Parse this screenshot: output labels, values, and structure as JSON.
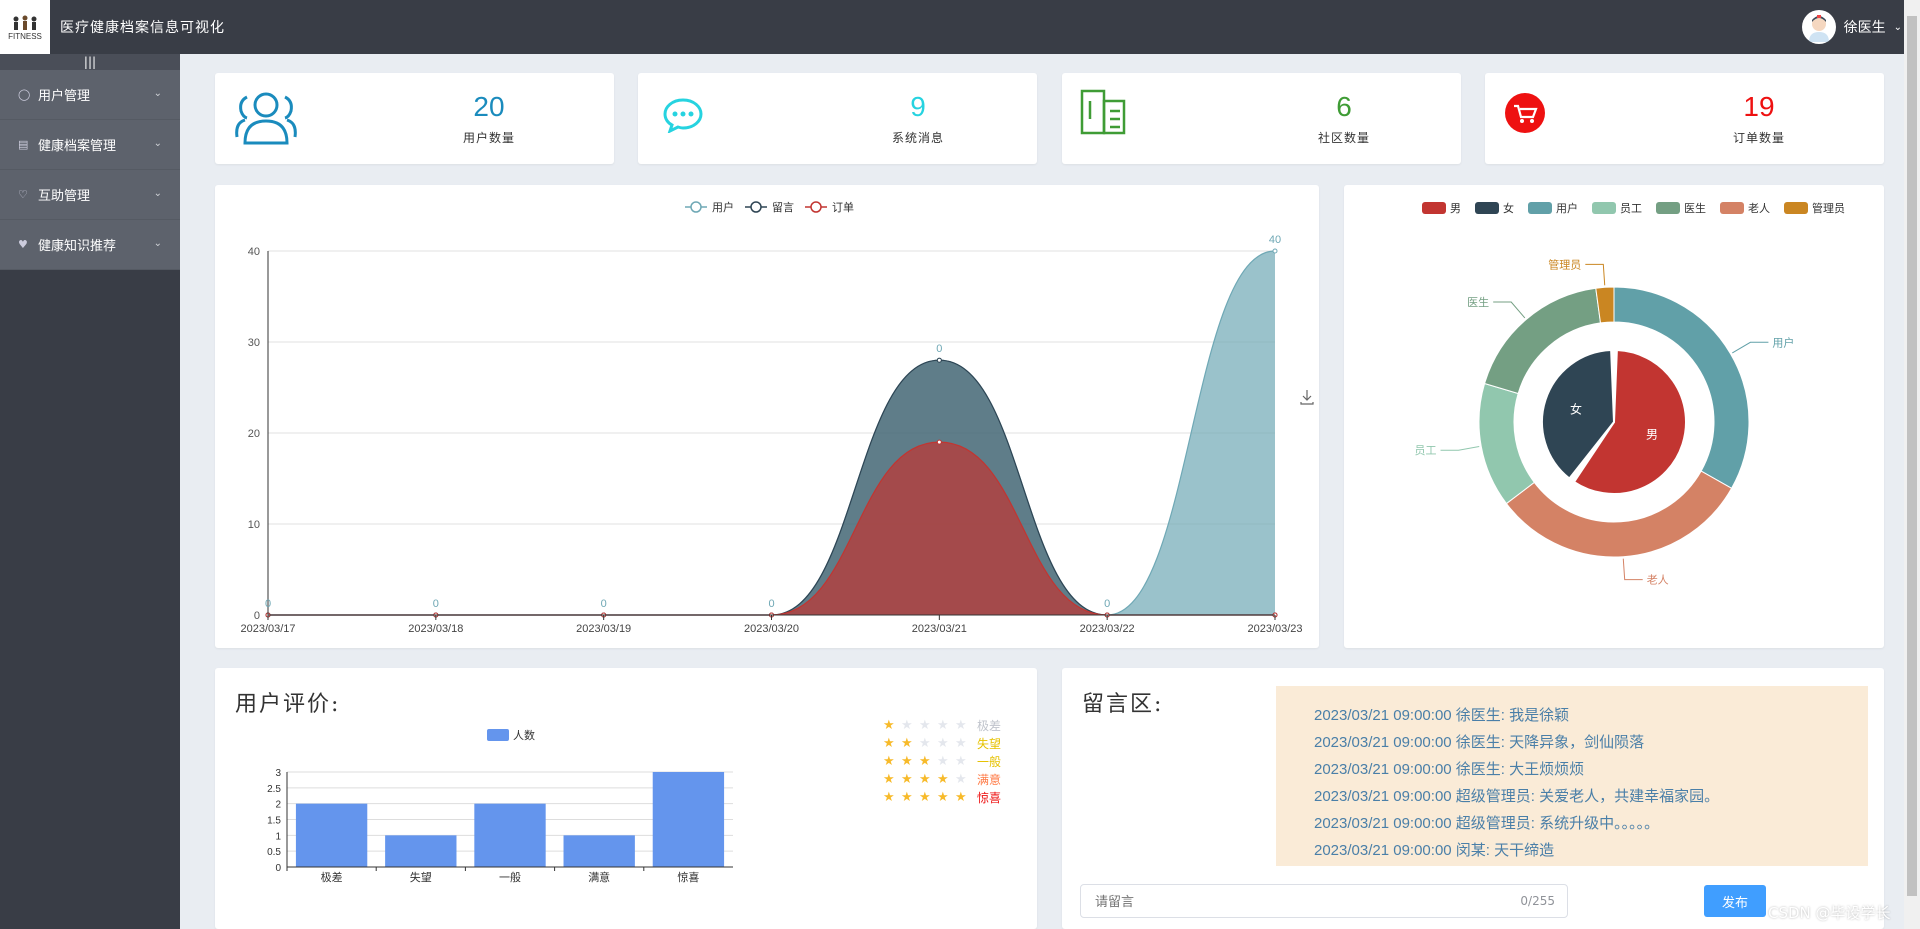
{
  "header": {
    "logo_text": "FITNESS",
    "app_title": "医疗健康档案信息可视化",
    "user_name": "徐医生"
  },
  "sidebar": {
    "toggle": "|||",
    "items": [
      {
        "label": "用户管理",
        "icon": "user-icon"
      },
      {
        "label": "健康档案管理",
        "icon": "file-icon"
      },
      {
        "label": "互助管理",
        "icon": "heart-icon"
      },
      {
        "label": "健康知识推荐",
        "icon": "heartbeat-icon"
      }
    ]
  },
  "stats": [
    {
      "value": "20",
      "label": "用户数量",
      "icon": "users-icon",
      "color": "#1a8bbd"
    },
    {
      "value": "9",
      "label": "系统消息",
      "icon": "chat-icon",
      "color": "#26d3e0"
    },
    {
      "value": "6",
      "label": "社区数量",
      "icon": "building-icon",
      "color": "#3f9c35"
    },
    {
      "value": "19",
      "label": "订单数量",
      "icon": "cart-icon",
      "color": "#ee1111"
    }
  ],
  "line_chart": {
    "chart_data": {
      "type": "area",
      "x": [
        "2023/03/17",
        "2023/03/18",
        "2023/03/19",
        "2023/03/20",
        "2023/03/21",
        "2023/03/22",
        "2023/03/23"
      ],
      "ylim": [
        0,
        40
      ],
      "yticks": [
        0,
        10,
        20,
        30,
        40
      ],
      "grid": true,
      "legend_position": "top",
      "series": [
        {
          "name": "用户",
          "color": "#6fa8b5",
          "values": [
            0,
            0,
            0,
            0,
            28,
            0,
            40
          ]
        },
        {
          "name": "留言",
          "color": "#2f4554",
          "values": [
            0,
            0,
            0,
            0,
            28,
            0,
            0
          ]
        },
        {
          "name": "订单",
          "color": "#c23531",
          "values": [
            0,
            0,
            0,
            0,
            19,
            0,
            0
          ]
        }
      ],
      "data_labels": [
        "0",
        "0",
        "0",
        "0",
        "0",
        "0",
        "40"
      ]
    }
  },
  "pie_chart": {
    "chart_data": {
      "type": "pie",
      "legend_position": "top",
      "legend": [
        "男",
        "女",
        "用户",
        "员工",
        "医生",
        "老人",
        "管理员"
      ],
      "inner": [
        {
          "name": "男",
          "value": 12,
          "color": "#c23531"
        },
        {
          "name": "女",
          "value": 8,
          "color": "#2f4554"
        }
      ],
      "outer": [
        {
          "name": "用户",
          "value": 20,
          "color": "#61a0a8"
        },
        {
          "name": "老人",
          "value": 19,
          "color": "#d48265"
        },
        {
          "name": "员工",
          "value": 9,
          "color": "#91c7ae"
        },
        {
          "name": "医生",
          "value": 11,
          "color": "#749f83"
        },
        {
          "name": "管理员",
          "value": 1.3,
          "color": "#ca8622"
        }
      ]
    }
  },
  "rating": {
    "title": "用户评价:",
    "chart_data": {
      "type": "bar",
      "legend": [
        "人数"
      ],
      "legend_position": "top",
      "categories": [
        "极差",
        "失望",
        "一般",
        "满意",
        "惊喜"
      ],
      "series": [
        {
          "name": "人数",
          "values": [
            2,
            1,
            2,
            1,
            3
          ]
        }
      ],
      "ylim": [
        0,
        3
      ],
      "yticks": [
        "0",
        "0.5",
        "1",
        "1.5",
        "2",
        "2.5",
        "3"
      ],
      "color": "#6495ed"
    },
    "stars": [
      {
        "filled": 1,
        "label": "极差",
        "color": "#c0c4cc"
      },
      {
        "filled": 2,
        "label": "失望",
        "color": "#e6c200"
      },
      {
        "filled": 3,
        "label": "一般",
        "color": "#e6c200"
      },
      {
        "filled": 4,
        "label": "满意",
        "color": "#ff7a45"
      },
      {
        "filled": 5,
        "label": "惊喜",
        "color": "#ee1111"
      }
    ]
  },
  "messages": {
    "title": "留言区:",
    "items": [
      "2023/03/21 09:00:00 徐医生: 我是徐颖",
      "2023/03/21 09:00:00 徐医生: 天降异象，剑仙陨落",
      "2023/03/21 09:00:00 徐医生: 大王烦烦烦",
      "2023/03/21 09:00:00 超级管理员: 关爱老人，共建幸福家园。",
      "2023/03/21 09:00:00 超级管理员: 系统升级中。。。。。",
      "2023/03/21 09:00:00 闵某: 天干缔造"
    ],
    "input_placeholder": "请留言",
    "counter": "0/255",
    "publish_label": "发布"
  },
  "watermark": "CSDN @毕设学长"
}
